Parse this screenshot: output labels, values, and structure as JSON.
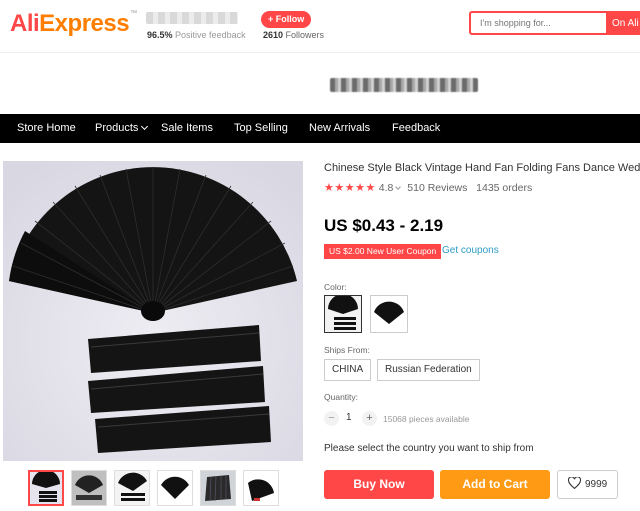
{
  "header": {
    "logo_ali": "Ali",
    "logo_express": "Express",
    "logo_tm": "™",
    "positive_pct": "96.5%",
    "positive_label": "Positive feedback",
    "follow_label": "+ Follow",
    "followers_count": "2610",
    "followers_label": "Followers",
    "search_placeholder": "I'm shopping for...",
    "search_button": "On Ali"
  },
  "nav": {
    "items": [
      "Store Home",
      "Products",
      "Sale Items",
      "Top Selling",
      "New Arrivals",
      "Feedback"
    ]
  },
  "product": {
    "title": "Chinese Style Black Vintage Hand Fan Folding Fans Dance Wedding Party",
    "stars": "★★★★★",
    "rating": "4.8",
    "reviews": "510 Reviews",
    "orders": "1435 orders",
    "price": "US $0.43 - 2.19",
    "coupon_tag": "US $2.00 New User Coupon",
    "get_coupons": "Get coupons",
    "color_label": "Color:",
    "ships_from_label": "Ships From:",
    "ships_from_options": [
      "CHINA",
      "Russian Federation"
    ],
    "quantity_label": "Quantity:",
    "qty_minus": "−",
    "qty_value": "1",
    "qty_plus": "+",
    "available": "15068 pieces available",
    "ship_msg": "Please select the country you want to ship from",
    "buy_now": "Buy Now",
    "add_to_cart": "Add to Cart",
    "wishlist_count": "9999"
  },
  "colors": {
    "brand_red": "#ff4747",
    "brand_orange": "#ff9a15",
    "link_blue": "#2e9cc3"
  }
}
